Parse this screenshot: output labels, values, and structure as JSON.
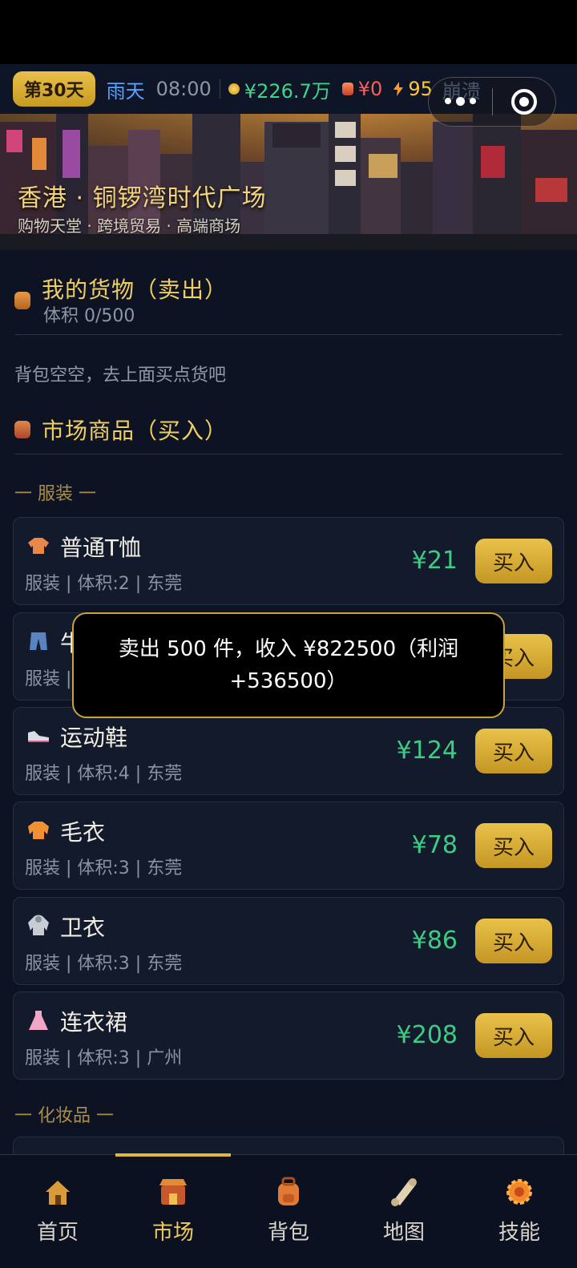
{
  "topbar": {
    "day": "第30天",
    "weather": "雨天",
    "time": "08:00",
    "money": "¥226.7万",
    "debt": "¥0",
    "energy": "95",
    "status": "崩溃"
  },
  "location": {
    "title": "香港 · 铜锣湾时代广场",
    "subtitle": "购物天堂 · 跨境贸易 · 高端商场"
  },
  "inventory": {
    "title": "我的货物（卖出）",
    "volume": "体积 0/500",
    "empty_hint": "背包空空，去上面买点货吧"
  },
  "market": {
    "title": "市场商品（买入）",
    "categories": [
      {
        "label": "一 服装 一",
        "items": [
          {
            "icon": "tshirt-icon",
            "name": "普通T恤",
            "meta": "服装 | 体积:2 | 东莞",
            "price": "¥21",
            "buy": "买入"
          },
          {
            "icon": "jeans-icon",
            "name": "牛仔裤",
            "meta": "服装 | 体积:2 | 东莞",
            "price": "",
            "buy": "买入"
          },
          {
            "icon": "sneaker-icon",
            "name": "运动鞋",
            "meta": "服装 | 体积:4 | 东莞",
            "price": "¥124",
            "buy": "买入"
          },
          {
            "icon": "sweater-icon",
            "name": "毛衣",
            "meta": "服装 | 体积:3 | 东莞",
            "price": "¥78",
            "buy": "买入"
          },
          {
            "icon": "hoodie-icon",
            "name": "卫衣",
            "meta": "服装 | 体积:3 | 东莞",
            "price": "¥86",
            "buy": "买入"
          },
          {
            "icon": "dress-icon",
            "name": "连衣裙",
            "meta": "服装 | 体积:3 | 广州",
            "price": "¥208",
            "buy": "买入"
          }
        ]
      },
      {
        "label": "一 化妆品 一",
        "items": []
      }
    ]
  },
  "toast": {
    "message": "卖出 500 件，收入 ¥822500（利润 +536500）"
  },
  "tabs": [
    {
      "icon": "home-icon",
      "label": "首页"
    },
    {
      "icon": "market-icon",
      "label": "市场"
    },
    {
      "icon": "backpack-icon",
      "label": "背包"
    },
    {
      "icon": "map-icon",
      "label": "地图"
    },
    {
      "icon": "skills-icon",
      "label": "技能"
    }
  ],
  "active_tab": "市场",
  "colors": {
    "accent_gold": "#e4b73a",
    "price_green": "#3ecb84",
    "background": "#0d1322"
  }
}
